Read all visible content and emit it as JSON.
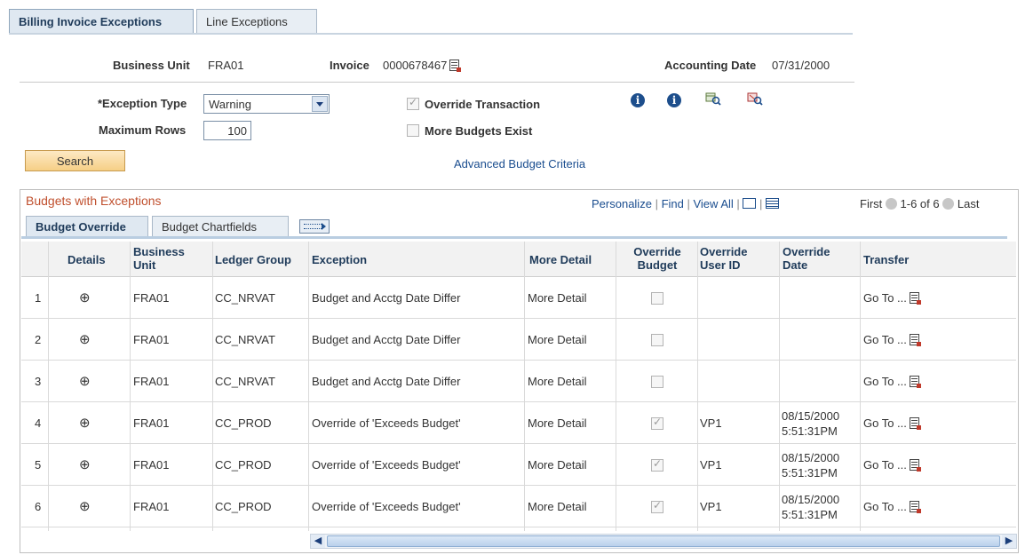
{
  "tabs": [
    {
      "label": "Billing Invoice Exceptions",
      "active": true
    },
    {
      "label": "Line Exceptions",
      "active": false
    }
  ],
  "header": {
    "business_unit_label": "Business Unit",
    "business_unit_value": "FRA01",
    "invoice_label": "Invoice",
    "invoice_value": "0000678467",
    "accounting_date_label": "Accounting Date",
    "accounting_date_value": "07/31/2000"
  },
  "form": {
    "exception_type_label": "*Exception Type",
    "exception_type_value": "Warning",
    "max_rows_label": "Maximum Rows",
    "max_rows_value": "100",
    "override_transaction_label": "Override Transaction",
    "override_transaction_checked": true,
    "more_budgets_label": "More Budgets Exist",
    "more_budgets_checked": false,
    "search_label": "Search",
    "advanced_link": "Advanced Budget Criteria"
  },
  "grid": {
    "title": "Budgets with Exceptions",
    "personalize": "Personalize",
    "find": "Find",
    "view_all": "View All",
    "pagination": {
      "first": "First",
      "range": "1-6 of 6",
      "last": "Last"
    },
    "subtabs": [
      {
        "label": "Budget Override",
        "active": true
      },
      {
        "label": "Budget Chartfields",
        "active": false
      }
    ],
    "columns": {
      "details": "Details",
      "business_unit": "Business Unit",
      "ledger_group": "Ledger Group",
      "exception": "Exception",
      "more_detail": "More Detail",
      "override_budget": "Override Budget",
      "override_user": "Override User ID",
      "override_date": "Override Date",
      "transfer": "Transfer"
    },
    "rows": [
      {
        "num": "1",
        "bu": "FRA01",
        "ledger": "CC_NRVAT",
        "exception": "Budget and Acctg Date Differ",
        "more": "More Detail",
        "override": false,
        "user": "",
        "date1": "",
        "date2": "",
        "transfer": "Go To ..."
      },
      {
        "num": "2",
        "bu": "FRA01",
        "ledger": "CC_NRVAT",
        "exception": "Budget and Acctg Date Differ",
        "more": "More Detail",
        "override": false,
        "user": "",
        "date1": "",
        "date2": "",
        "transfer": "Go To ..."
      },
      {
        "num": "3",
        "bu": "FRA01",
        "ledger": "CC_NRVAT",
        "exception": "Budget and Acctg Date Differ",
        "more": "More Detail",
        "override": false,
        "user": "",
        "date1": "",
        "date2": "",
        "transfer": "Go To ..."
      },
      {
        "num": "4",
        "bu": "FRA01",
        "ledger": "CC_PROD",
        "exception": "Override of 'Exceeds Budget'",
        "more": "More Detail",
        "override": true,
        "user": "VP1",
        "date1": "08/15/2000",
        "date2": "5:51:31PM",
        "transfer": "Go To ..."
      },
      {
        "num": "5",
        "bu": "FRA01",
        "ledger": "CC_PROD",
        "exception": "Override of 'Exceeds Budget'",
        "more": "More Detail",
        "override": true,
        "user": "VP1",
        "date1": "08/15/2000",
        "date2": "5:51:31PM",
        "transfer": "Go To ..."
      },
      {
        "num": "6",
        "bu": "FRA01",
        "ledger": "CC_PROD",
        "exception": "Override of 'Exceeds Budget'",
        "more": "More Detail",
        "override": true,
        "user": "VP1",
        "date1": "08/15/2000",
        "date2": "5:51:31PM",
        "transfer": "Go To ..."
      }
    ]
  }
}
